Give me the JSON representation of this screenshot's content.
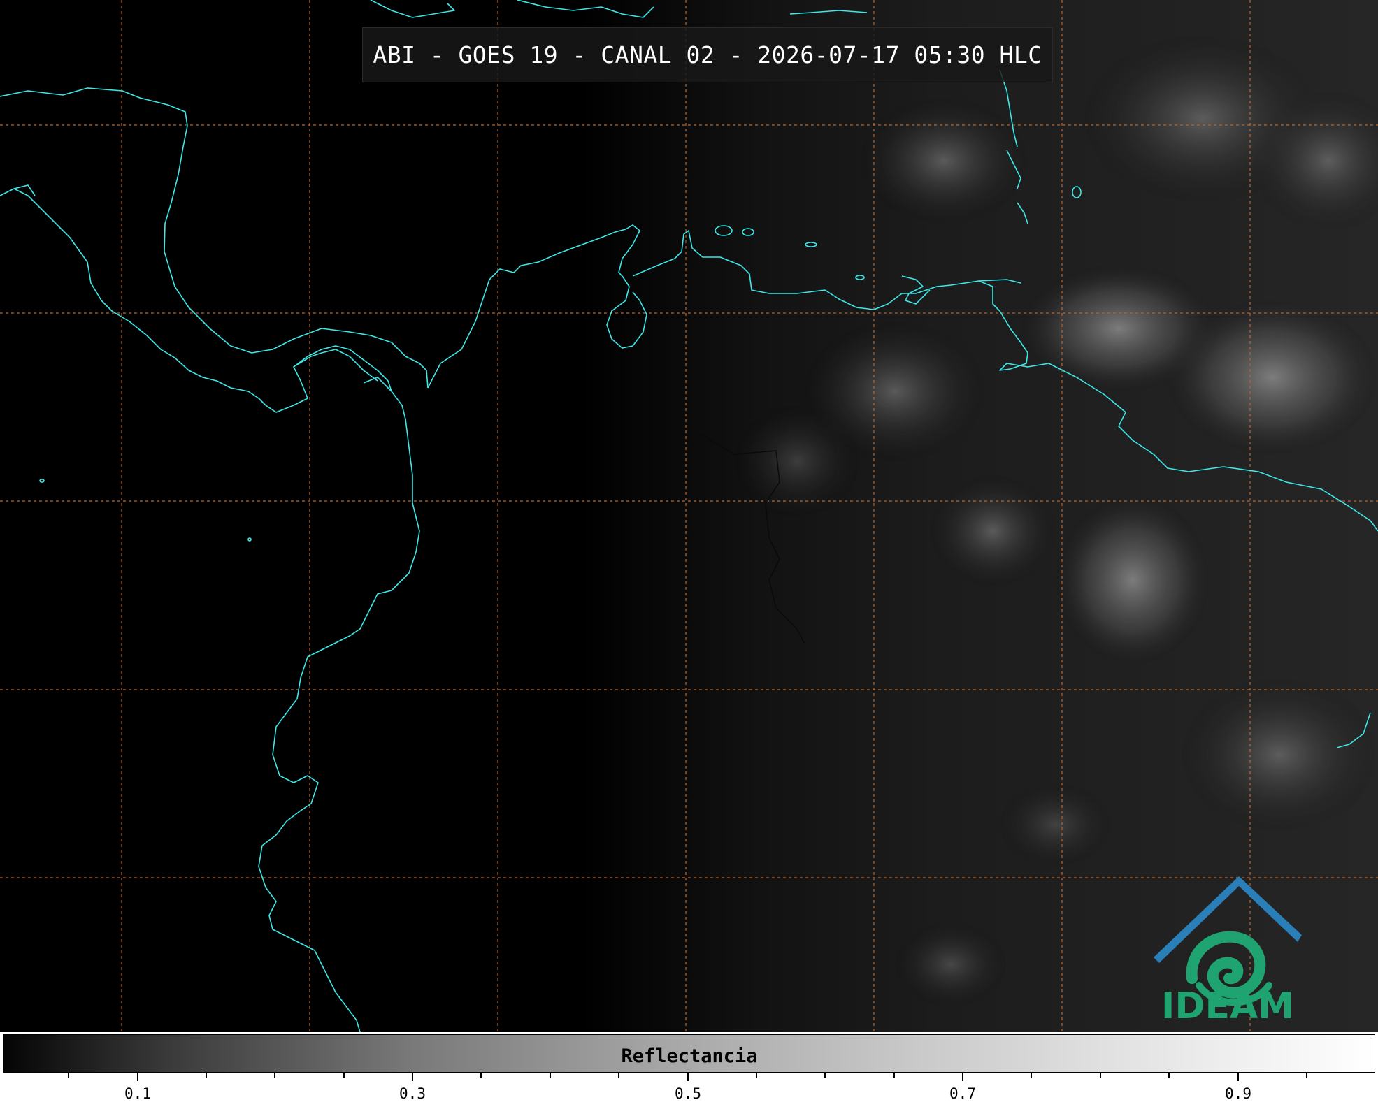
{
  "title": "ABI - GOES 19 - CANAL 02 - 2026-07-17 05:30 HLC",
  "logo": {
    "text": "IDEAM"
  },
  "colorbar": {
    "label": "Reflectancia",
    "tick_labels": [
      "0.1",
      "0.3",
      "0.5",
      "0.7",
      "0.9"
    ],
    "range": [
      0.0,
      1.0
    ]
  },
  "colors": {
    "coastline": "#3de8e8",
    "graticule": "#b8662a",
    "logo_green": "#1ea371",
    "logo_blue": "#2b7fb8"
  }
}
